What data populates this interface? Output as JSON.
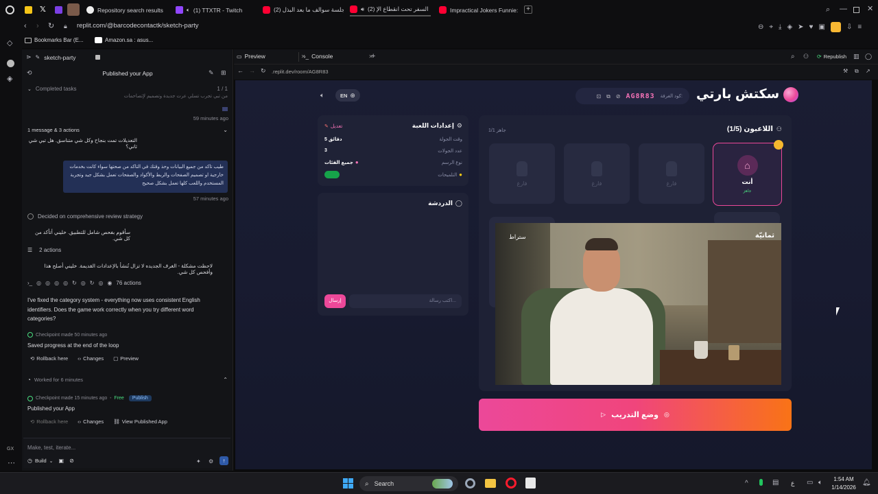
{
  "browser": {
    "tabs": [
      {
        "label": "Repository search results"
      },
      {
        "label": "(1) TTXTR - Twitch"
      },
      {
        "label": "جلسة سوالف ما بعد البذل (2)"
      },
      {
        "label": "السفر تحت انقطاع الإ (2)"
      },
      {
        "label": "Impractical Jokers Funnie:"
      }
    ],
    "url": "replit.com/@barcodecontactk/sketch-party",
    "bookmarks": [
      {
        "label": "Bookmarks Bar (E..."
      },
      {
        "label": "Amazon.sa : asus..."
      }
    ],
    "rail_label": "GX"
  },
  "replit": {
    "project_name": "sketch-party",
    "header_title": "Published your App",
    "completed_tasks": "Completed tasks",
    "task_count": "1 / 1",
    "fade_text": "من تبي تجرب تسلي عرت جديدة وتصميم لإتصاحمات",
    "time1": "59 minutes ago",
    "actions1": "1 message & 3 actions",
    "arabic1": "التعديلات تمت بنجاح وكل شي متناسق. هل تبي شي ثاني؟",
    "user_msg": "طيب تاكد من جميع البيانات وحذ وقتك في التاكد من صحتها سواء كانت بخدمات خارجية او تصميم الصفحات والربط والأكواد والصفحات تعمل بشكل جيد وتجربة المستخدم واللعب كلها تعمل بشكل صحيح",
    "time2": "57 minutes ago",
    "decided": "Decided on comprehensive review strategy",
    "arabic2": "سأقوم بفحص شامل للتطبيق. خليني أتأكد من كل شي.",
    "actions2": "2 actions",
    "arabic3": "لاحظت مشكلة - الغرف الجديده لا تزال تُنشأ بالإعدادات القديمة. خليني أصلح هذا وأفحص كل شي.",
    "actions3": "76 actions",
    "english_msg": "I've fixed the category system - everything now uses consistent English identifiers. Does the game work correctly when you try different word categories?",
    "checkpoint1": "Checkpoint made 50 minutes ago",
    "saved": "Saved progress at the end of the loop",
    "rollback": "Rollback here",
    "changes": "Changes",
    "preview": "Preview",
    "worked": "Worked for 6 minutes",
    "checkpoint2": "Checkpoint made 15 minutes ago",
    "free": "Free",
    "publish_badge": "Publish",
    "published_app": "Published your App",
    "view_published": "View Published App",
    "input_placeholder": "Make, test, iterate...",
    "build": "Build"
  },
  "workspace": {
    "tab_preview": "Preview",
    "tab_console": "Console",
    "republish": "Republish",
    "inner_url": ".replit.dev/room/AG8R83"
  },
  "game": {
    "lang": "EN",
    "room_label": "كود الغرفة:",
    "room_code": "AG8R83",
    "title": "سكتش بارتي",
    "players_title": "اللاعبون (1/5)",
    "ready": "1/1 جاهز",
    "you": "أنت",
    "you_status": "جاهز",
    "empty": "فارغ",
    "settings_title": "إعدادات اللعبة",
    "edit": "تعديل",
    "round_time_label": "وقت الجولة",
    "round_time_value": "5 دقائق",
    "rounds_label": "عدد الجولات",
    "rounds_value": "3",
    "draw_type_label": "نوع الرسم",
    "draw_type_value": "جميع الفئات",
    "hints_label": "التلميحات",
    "chat_title": "الدردشة",
    "chat_placeholder": "اكتب رسالة...",
    "send": "إرسال",
    "practice_button": "وضع التدريب",
    "video_caption_right": "ثمانيّة",
    "video_caption_left": "ستراط"
  },
  "taskbar": {
    "search": "Search",
    "time": "1:54 AM",
    "date": "1/14/2026",
    "lang": "ع"
  },
  "colors": {
    "accent_pink": "#ec4899",
    "accent_orange": "#f97316",
    "room_code": "#f472b6",
    "toggle_on": "#22c55e"
  }
}
